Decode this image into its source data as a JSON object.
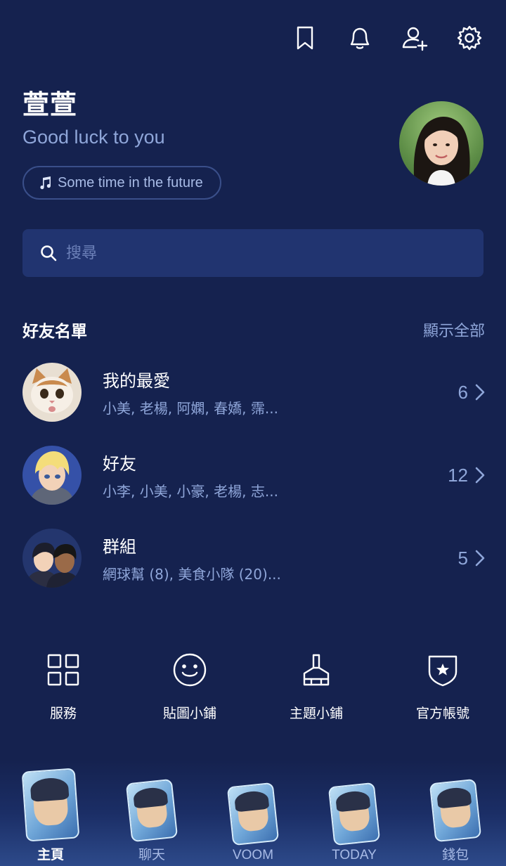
{
  "header": {
    "icons": [
      "bookmark-icon",
      "bell-icon",
      "add-friend-icon",
      "gear-icon"
    ]
  },
  "profile": {
    "name": "萱萱",
    "status": "Good luck to you",
    "music": "Some time in the future"
  },
  "search": {
    "placeholder": "搜尋"
  },
  "friends_section": {
    "title": "好友名單",
    "show_all": "顯示全部",
    "rows": [
      {
        "title": "我的最愛",
        "subtitle": "小美, 老楊, 阿嫻, 春嬌, 霈...",
        "count": "6"
      },
      {
        "title": "好友",
        "subtitle": "小李, 小美, 小豪, 老楊, 志...",
        "count": "12"
      },
      {
        "title": "群組",
        "subtitle": "網球幫 (8), 美食小隊 (20)...",
        "count": "5"
      }
    ]
  },
  "services": [
    {
      "label": "服務",
      "icon": "grid-icon"
    },
    {
      "label": "貼圖小鋪",
      "icon": "smiley-icon"
    },
    {
      "label": "主題小鋪",
      "icon": "brush-icon"
    },
    {
      "label": "官方帳號",
      "icon": "shield-star-icon"
    }
  ],
  "bottom_nav": [
    {
      "label": "主頁",
      "active": true
    },
    {
      "label": "聊天",
      "active": false
    },
    {
      "label": "VOOM",
      "active": false
    },
    {
      "label": "TODAY",
      "active": false
    },
    {
      "label": "錢包",
      "active": false
    }
  ],
  "colors": {
    "background": "#15224f",
    "search_bg": "#213470",
    "muted_text": "#8fa6d9"
  }
}
